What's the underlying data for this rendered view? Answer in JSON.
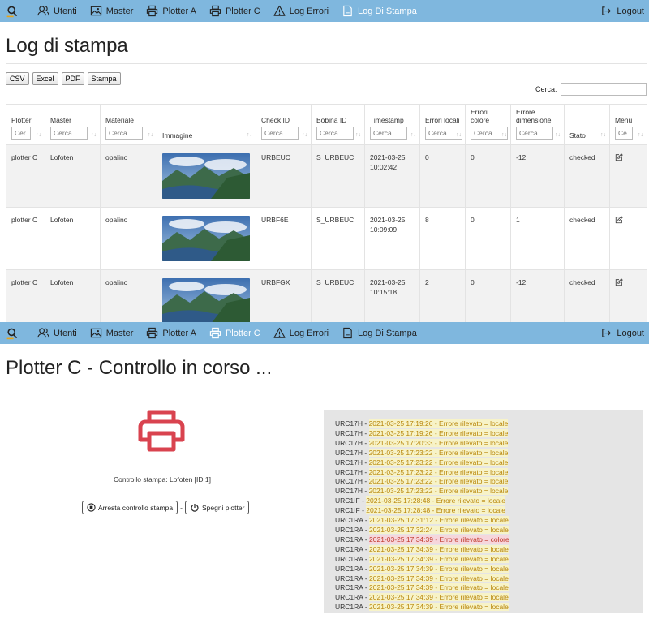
{
  "nav": {
    "items": [
      {
        "label": "Utenti",
        "icon": "users-icon"
      },
      {
        "label": "Master",
        "icon": "image-icon"
      },
      {
        "label": "Plotter A",
        "icon": "printer-icon"
      },
      {
        "label": "Plotter C",
        "icon": "printer-icon"
      },
      {
        "label": "Log Errori",
        "icon": "warning-icon"
      },
      {
        "label": "Log Di Stampa",
        "icon": "document-icon"
      }
    ],
    "logout": "Logout"
  },
  "top": {
    "title": "Log di stampa",
    "active_nav": "Log Di Stampa",
    "export": [
      "CSV",
      "Excel",
      "PDF",
      "Stampa"
    ],
    "search_label": "Cerca:",
    "filter_placeholder": "Cerca",
    "columns": [
      {
        "label": "Plotter",
        "filter": "Cer"
      },
      {
        "label": "Master",
        "filter": "Cerca"
      },
      {
        "label": "Materiale",
        "filter": "Cerca"
      },
      {
        "label": "Immagine"
      },
      {
        "label": "Check ID",
        "filter": "Cerca"
      },
      {
        "label": "Bobina ID",
        "filter": "Cerca"
      },
      {
        "label": "Timestamp",
        "filter": "Cerca"
      },
      {
        "label": "Errori locali",
        "filter": "Cerca"
      },
      {
        "label": "Errori colore",
        "filter": "Cerca"
      },
      {
        "label": "Errore dimensione",
        "filter": "Cerca"
      },
      {
        "label": "Stato"
      },
      {
        "label": "Menu",
        "filter": "Ce"
      }
    ],
    "rows": [
      {
        "plotter": "plotter C",
        "master": "Lofoten",
        "materiale": "opalino",
        "check_id": "URBEUC",
        "bobina_id": "S_URBEUC",
        "ts_date": "2021-03-25",
        "ts_time": "10:02:42",
        "err_locali": "0",
        "err_colore": "0",
        "err_dim": "-12",
        "stato": "checked"
      },
      {
        "plotter": "plotter C",
        "master": "Lofoten",
        "materiale": "opalino",
        "check_id": "URBF6E",
        "bobina_id": "S_URBEUC",
        "ts_date": "2021-03-25",
        "ts_time": "10:09:09",
        "err_locali": "8",
        "err_colore": "0",
        "err_dim": "1",
        "stato": "checked"
      },
      {
        "plotter": "plotter C",
        "master": "Lofoten",
        "materiale": "opalino",
        "check_id": "URBFGX",
        "bobina_id": "S_URBEUC",
        "ts_date": "2021-03-25",
        "ts_time": "10:15:18",
        "err_locali": "2",
        "err_colore": "0",
        "err_dim": "-12",
        "stato": "checked"
      }
    ]
  },
  "bottom": {
    "title": "Plotter C - Controllo in corso ...",
    "active_nav": "Plotter C",
    "status": "Controllo stampa: Lofoten [ID 1]",
    "stop_label": "Arresta controllo stampa",
    "separator": "-",
    "power_label": "Spegni plotter",
    "log_separator": " - ",
    "log": [
      {
        "code": "URC17H",
        "msg": "2021-03-25 17:19:26 - Errore rilevato = locale",
        "type": "locale"
      },
      {
        "code": "URC17H",
        "msg": "2021-03-25 17:19:26 - Errore rilevato = locale",
        "type": "locale"
      },
      {
        "code": "URC17H",
        "msg": "2021-03-25 17:20:33 - Errore rilevato = locale",
        "type": "locale"
      },
      {
        "code": "URC17H",
        "msg": "2021-03-25 17:23:22 - Errore rilevato = locale",
        "type": "locale"
      },
      {
        "code": "URC17H",
        "msg": "2021-03-25 17:23:22 - Errore rilevato = locale",
        "type": "locale"
      },
      {
        "code": "URC17H",
        "msg": "2021-03-25 17:23:22 - Errore rilevato = locale",
        "type": "locale"
      },
      {
        "code": "URC17H",
        "msg": "2021-03-25 17:23:22 - Errore rilevato = locale",
        "type": "locale"
      },
      {
        "code": "URC17H",
        "msg": "2021-03-25 17:23:22 - Errore rilevato = locale",
        "type": "locale"
      },
      {
        "code": "URC1IF",
        "msg": "2021-03-25 17:28:48 - Errore rilevato = locale",
        "type": "locale"
      },
      {
        "code": "URC1IF",
        "msg": "2021-03-25 17:28:48 - Errore rilevato = locale",
        "type": "locale"
      },
      {
        "code": "URC1RA",
        "msg": "2021-03-25 17:31:12 - Errore rilevato = locale",
        "type": "locale"
      },
      {
        "code": "URC1RA",
        "msg": "2021-03-25 17:32:24 - Errore rilevato = locale",
        "type": "locale"
      },
      {
        "code": "URC1RA",
        "msg": "2021-03-25 17:34:39 - Errore rilevato = colore",
        "type": "colore"
      },
      {
        "code": "URC1RA",
        "msg": "2021-03-25 17:34:39 - Errore rilevato = locale",
        "type": "locale"
      },
      {
        "code": "URC1RA",
        "msg": "2021-03-25 17:34:39 - Errore rilevato = locale",
        "type": "locale"
      },
      {
        "code": "URC1RA",
        "msg": "2021-03-25 17:34:39 - Errore rilevato = locale",
        "type": "locale"
      },
      {
        "code": "URC1RA",
        "msg": "2021-03-25 17:34:39 - Errore rilevato = locale",
        "type": "locale"
      },
      {
        "code": "URC1RA",
        "msg": "2021-03-25 17:34:39 - Errore rilevato = locale",
        "type": "locale"
      },
      {
        "code": "URC1RA",
        "msg": "2021-03-25 17:34:39 - Errore rilevato = locale",
        "type": "locale"
      },
      {
        "code": "URC1RA",
        "msg": "2021-03-25 17:34:39 - Errore rilevato = locale",
        "type": "locale"
      }
    ]
  },
  "colors": {
    "navbar": "#7fb7de",
    "printer": "#d9434f",
    "warning_text": "#b8860b",
    "error_text": "#c0392b"
  }
}
